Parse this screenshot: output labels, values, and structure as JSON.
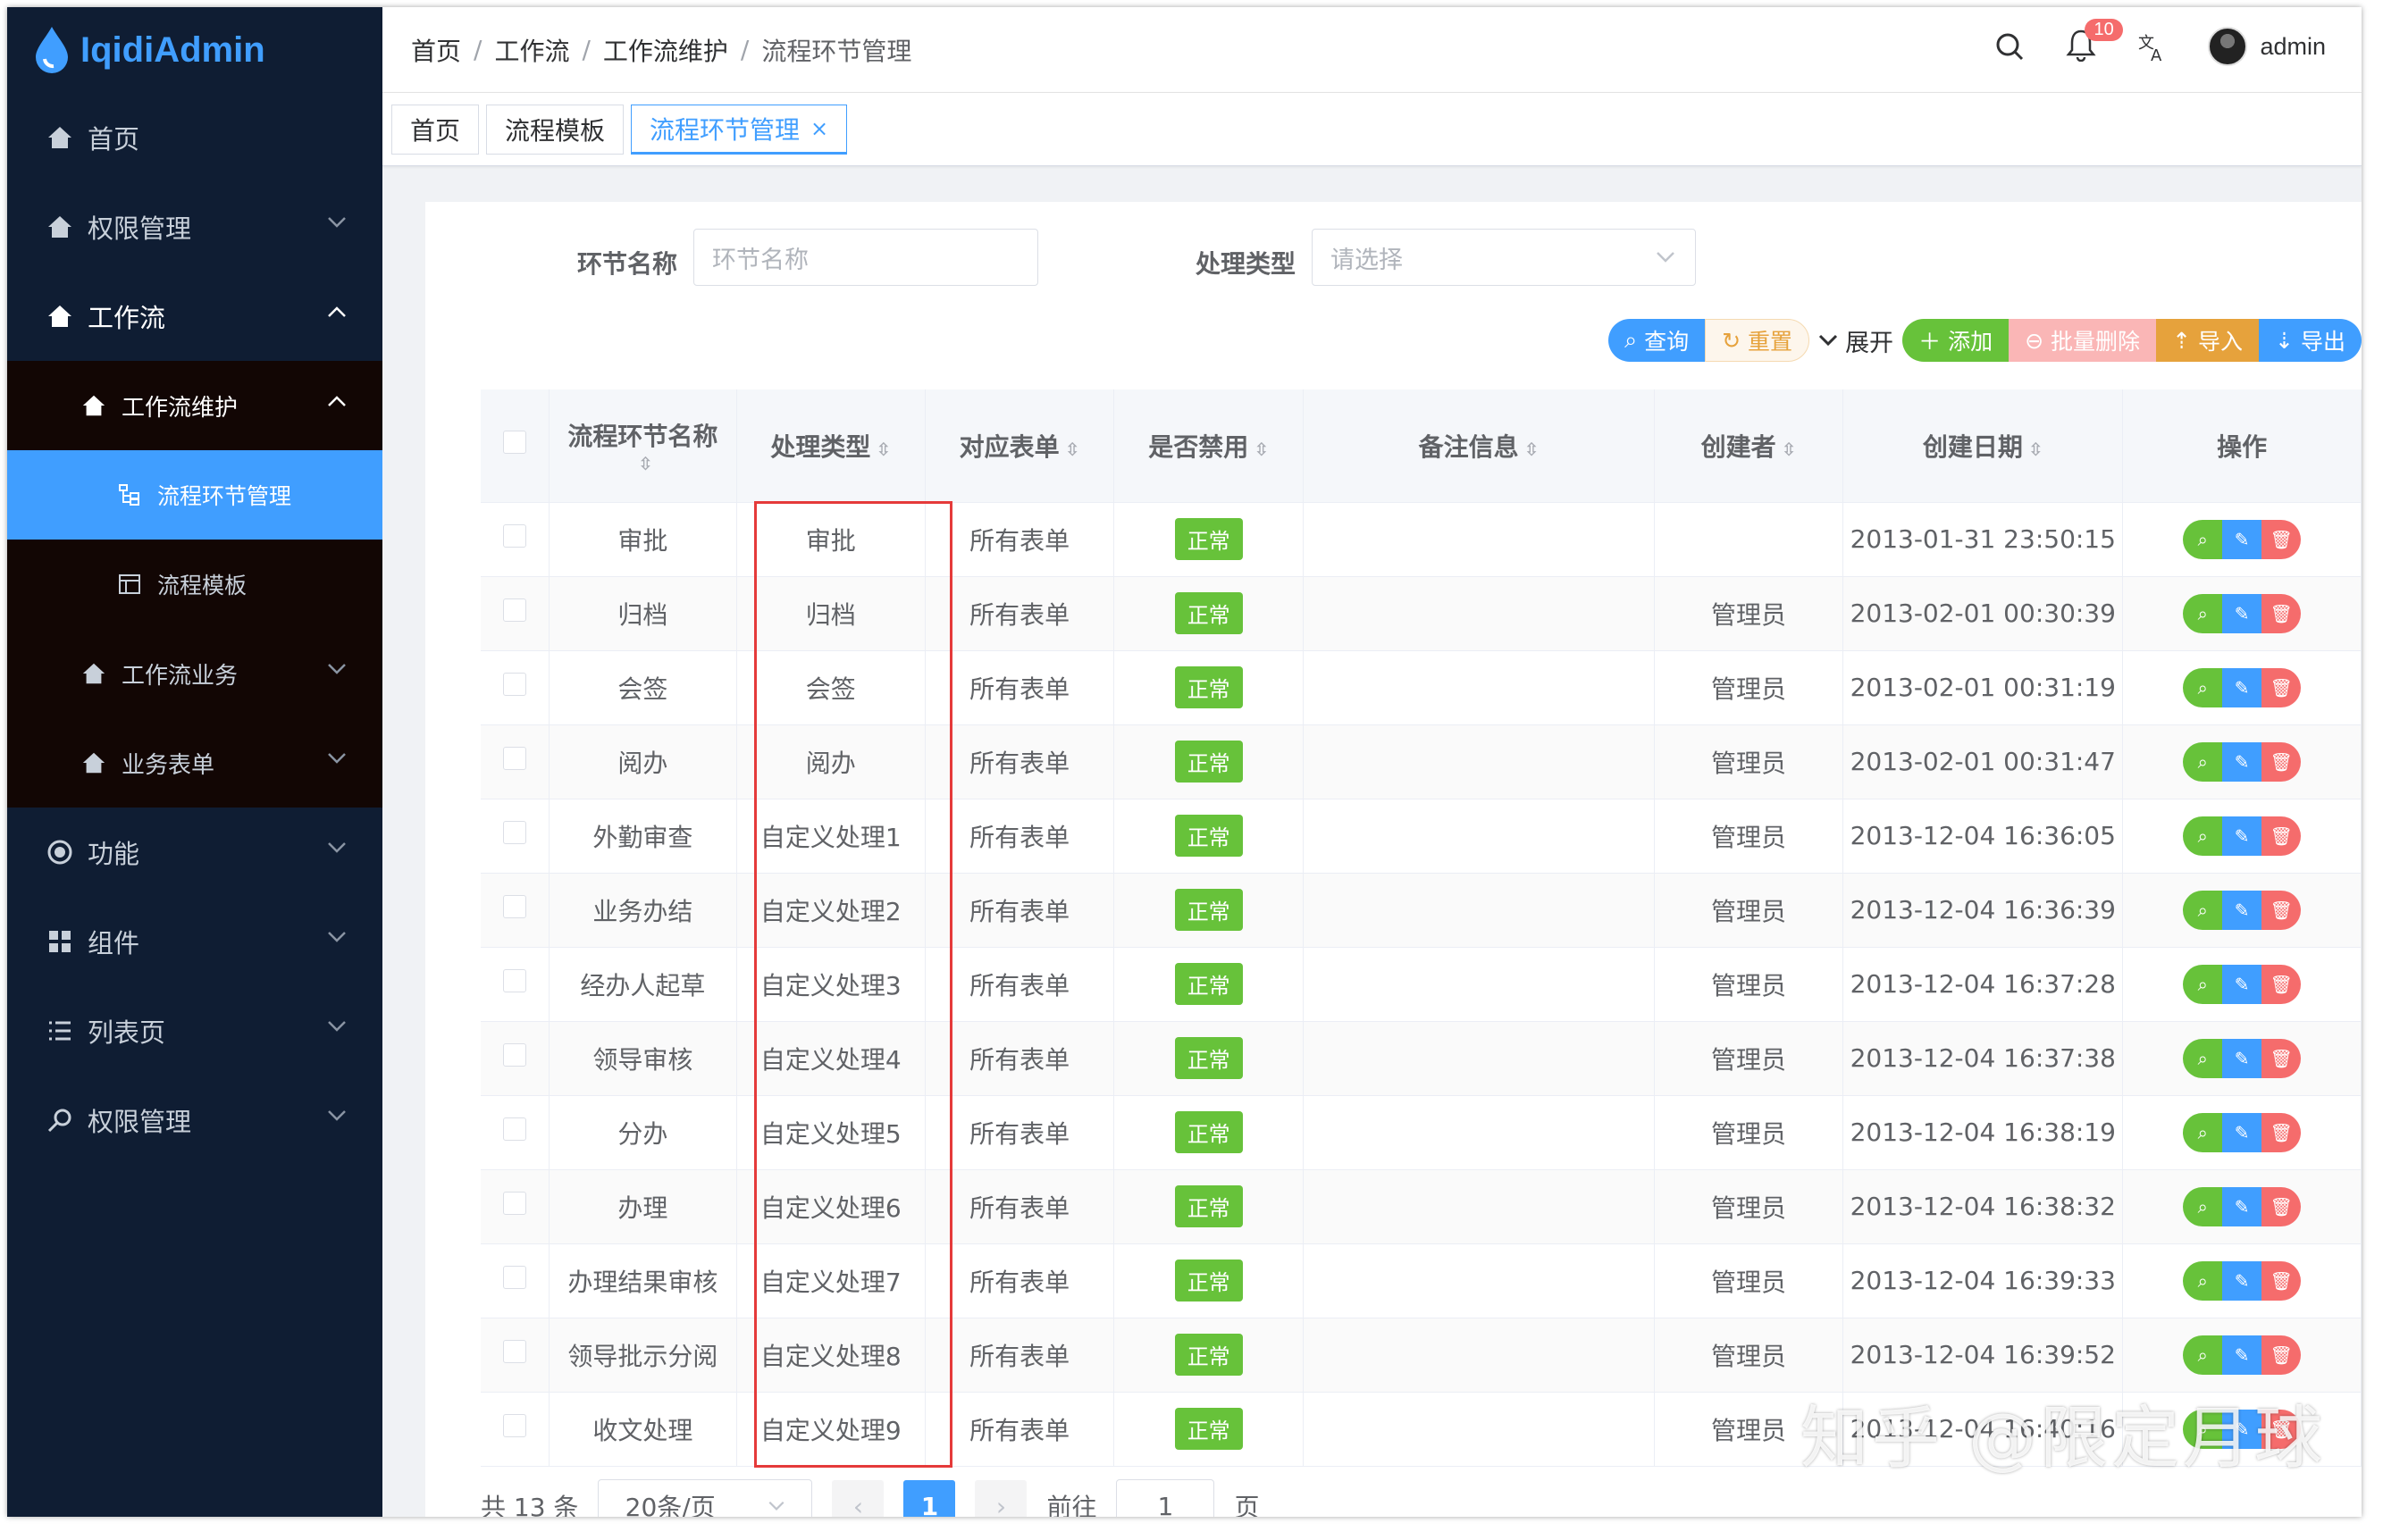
{
  "app": {
    "logo": "IqidiAdmin"
  },
  "sidebar": {
    "home": "首页",
    "perm": "权限管理",
    "workflow": "工作流",
    "wf_maint": "工作流维护",
    "node_mgmt": "流程环节管理",
    "template": "流程模板",
    "wf_biz": "工作流业务",
    "biz_form": "业务表单",
    "func": "功能",
    "comp": "组件",
    "listpage": "列表页",
    "perm2": "权限管理"
  },
  "breadcrumb": {
    "b1": "首页",
    "b2": "工作流",
    "b3": "工作流维护",
    "b4": "流程环节管理",
    "sep": "/"
  },
  "navbar": {
    "notify_count": "10",
    "user": "admin"
  },
  "tags": {
    "t1": "首页",
    "t2": "流程模板",
    "t3": "流程环节管理",
    "close": "×"
  },
  "search": {
    "name_label": "环节名称",
    "name_placeholder": "环节名称",
    "type_label": "处理类型",
    "type_placeholder": "请选择"
  },
  "toolbar": {
    "query": "查询",
    "reset": "重置",
    "expand": "展开",
    "add": "添加",
    "batch_delete": "批量删除",
    "import": "导入",
    "export": "导出"
  },
  "table": {
    "headers": {
      "name": "流程环节名称",
      "type": "处理类型",
      "form": "对应表单",
      "disabled": "是否禁用",
      "remark": "备注信息",
      "creator": "创建者",
      "date": "创建日期",
      "ops": "操作"
    },
    "rows": [
      {
        "name": "审批",
        "type": "审批",
        "form": "所有表单",
        "status": "正常",
        "remark": "",
        "creator": "",
        "date": "2013-01-31 23:50:15"
      },
      {
        "name": "归档",
        "type": "归档",
        "form": "所有表单",
        "status": "正常",
        "remark": "",
        "creator": "管理员",
        "date": "2013-02-01 00:30:39"
      },
      {
        "name": "会签",
        "type": "会签",
        "form": "所有表单",
        "status": "正常",
        "remark": "",
        "creator": "管理员",
        "date": "2013-02-01 00:31:19"
      },
      {
        "name": "阅办",
        "type": "阅办",
        "form": "所有表单",
        "status": "正常",
        "remark": "",
        "creator": "管理员",
        "date": "2013-02-01 00:31:47"
      },
      {
        "name": "外勤审查",
        "type": "自定义处理1",
        "form": "所有表单",
        "status": "正常",
        "remark": "",
        "creator": "管理员",
        "date": "2013-12-04 16:36:05"
      },
      {
        "name": "业务办结",
        "type": "自定义处理2",
        "form": "所有表单",
        "status": "正常",
        "remark": "",
        "creator": "管理员",
        "date": "2013-12-04 16:36:39"
      },
      {
        "name": "经办人起草",
        "type": "自定义处理3",
        "form": "所有表单",
        "status": "正常",
        "remark": "",
        "creator": "管理员",
        "date": "2013-12-04 16:37:28"
      },
      {
        "name": "领导审核",
        "type": "自定义处理4",
        "form": "所有表单",
        "status": "正常",
        "remark": "",
        "creator": "管理员",
        "date": "2013-12-04 16:37:38"
      },
      {
        "name": "分办",
        "type": "自定义处理5",
        "form": "所有表单",
        "status": "正常",
        "remark": "",
        "creator": "管理员",
        "date": "2013-12-04 16:38:19"
      },
      {
        "name": "办理",
        "type": "自定义处理6",
        "form": "所有表单",
        "status": "正常",
        "remark": "",
        "creator": "管理员",
        "date": "2013-12-04 16:38:32"
      },
      {
        "name": "办理结果审核",
        "type": "自定义处理7",
        "form": "所有表单",
        "status": "正常",
        "remark": "",
        "creator": "管理员",
        "date": "2013-12-04 16:39:33"
      },
      {
        "name": "领导批示分阅",
        "type": "自定义处理8",
        "form": "所有表单",
        "status": "正常",
        "remark": "",
        "creator": "管理员",
        "date": "2013-12-04 16:39:52"
      },
      {
        "name": "收文处理",
        "type": "自定义处理9",
        "form": "所有表单",
        "status": "正常",
        "remark": "",
        "creator": "管理员",
        "date": "2013-12-04 16:40:16"
      }
    ]
  },
  "pager": {
    "total": "共 13 条",
    "size": "20条/页",
    "current": "1",
    "goto": "前往",
    "page_input": "1",
    "page_unit": "页"
  },
  "watermark": "知乎 @限定月球",
  "colors": {
    "primary": "#409eff",
    "success": "#67c23a",
    "danger": "#f56c6c",
    "warning": "#e6a23c",
    "sidebar": "#0f1d33",
    "highlight": "#e53a3a"
  }
}
